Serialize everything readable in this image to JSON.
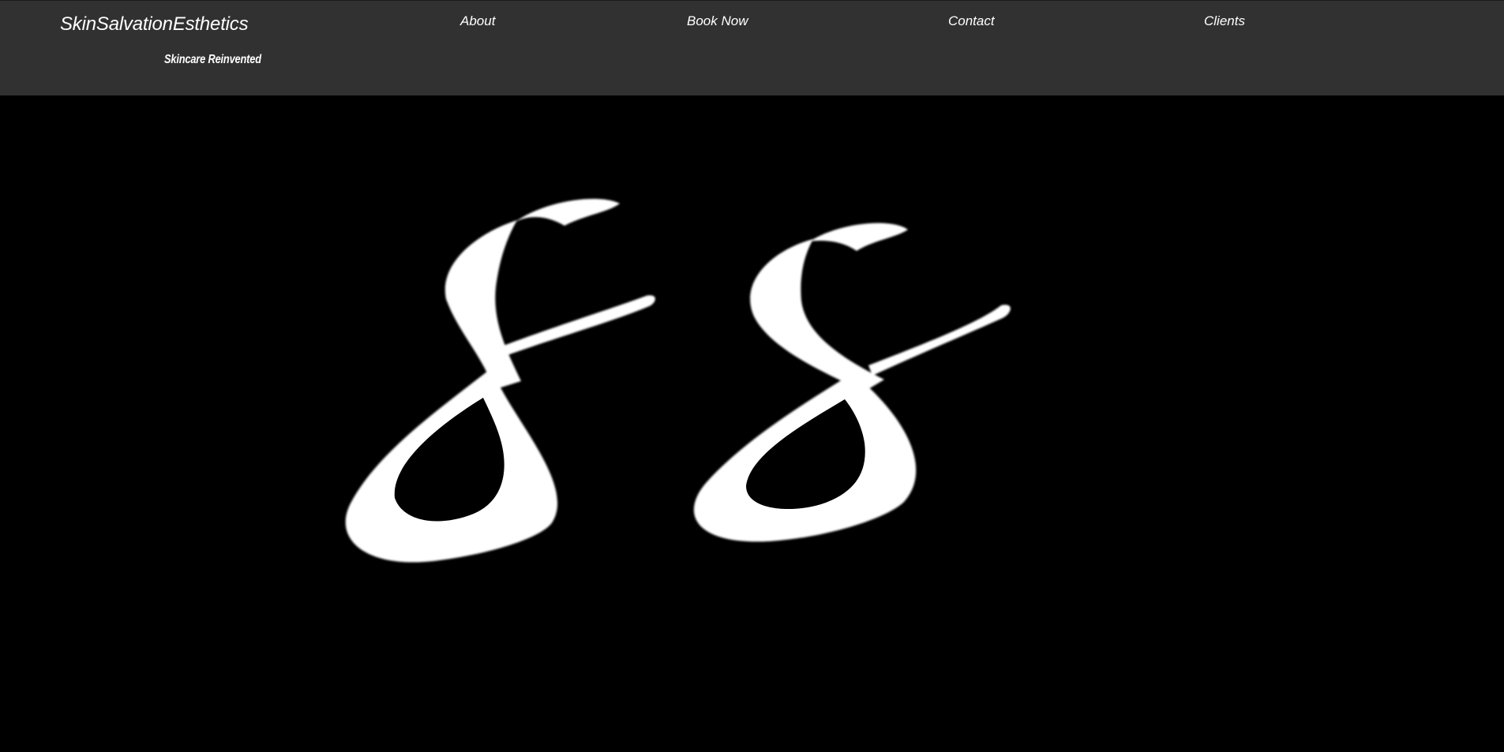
{
  "header": {
    "brand": "SkinSalvationEsthetics",
    "tagline": "Skincare Reinvented",
    "background_color": "#313131",
    "text_color": "#ffffff"
  },
  "nav": {
    "items": [
      {
        "label": "About"
      },
      {
        "label": "Book Now"
      },
      {
        "label": "Contact"
      },
      {
        "label": "Clients"
      }
    ]
  },
  "hero": {
    "background_color": "#000000",
    "logo": {
      "letters": "SS",
      "color": "#ffffff",
      "icon": "ss-monogram-logo"
    }
  }
}
